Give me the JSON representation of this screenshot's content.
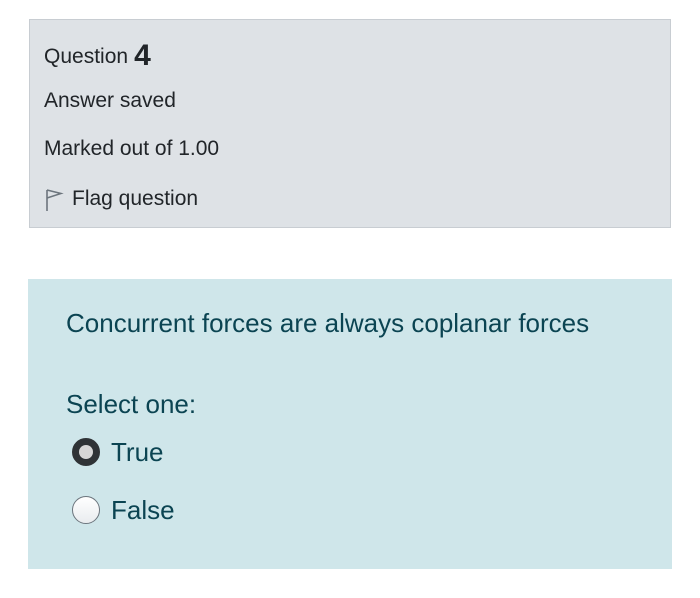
{
  "info": {
    "question_label": "Question",
    "question_number": "4",
    "state": "Answer saved",
    "grade": "Marked out of 1.00",
    "flag_label": "Flag question",
    "flag_icon": "flag-icon"
  },
  "question": {
    "text": "Concurrent forces are always coplanar forces",
    "prompt": "Select one:",
    "options": [
      {
        "label": "True",
        "selected": true
      },
      {
        "label": "False",
        "selected": false
      }
    ]
  },
  "colors": {
    "info_background": "#dee2e6",
    "question_background": "#cfe6ea",
    "question_text": "#0b4452"
  }
}
